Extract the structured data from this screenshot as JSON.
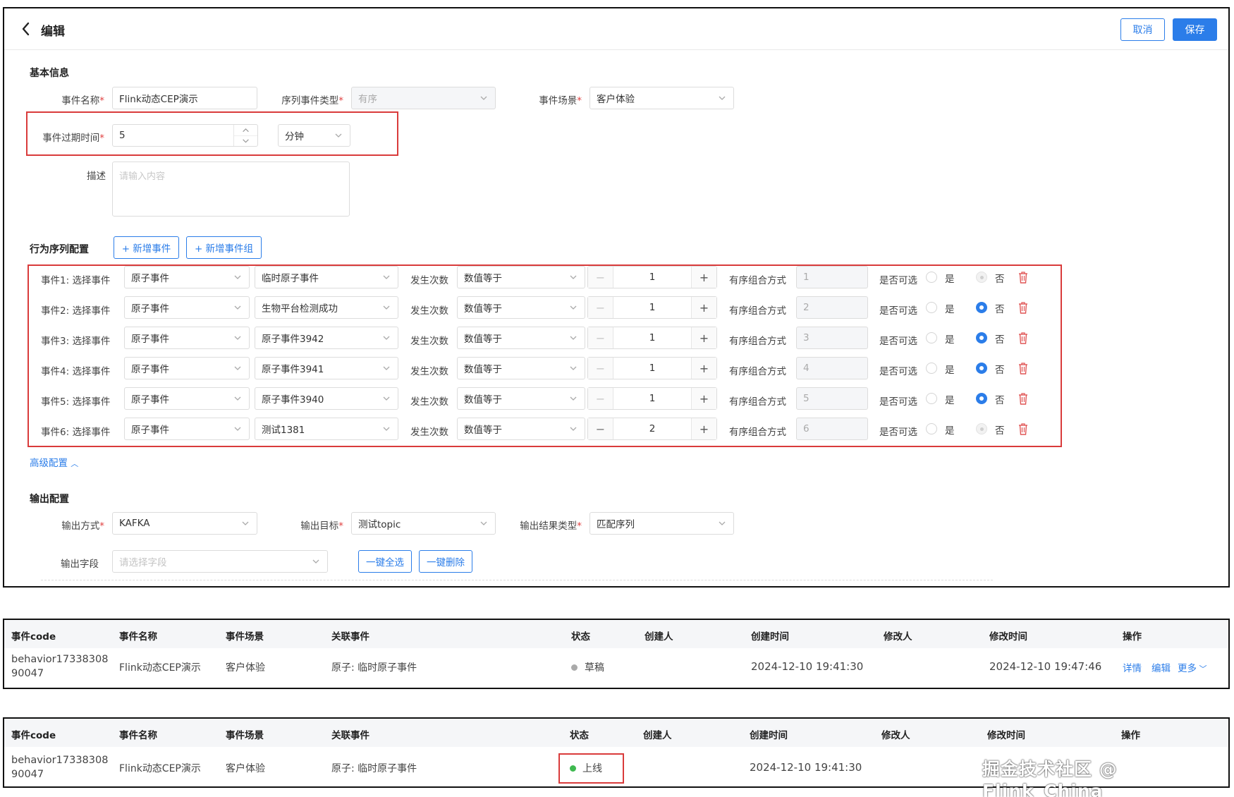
{
  "header": {
    "title": "编辑",
    "cancel": "取消",
    "save": "保存"
  },
  "basic": {
    "section": "基本信息",
    "event_name_label": "事件名称",
    "event_name_value": "Flink动态CEP演示",
    "seq_type_label": "序列事件类型",
    "seq_type_value": "有序",
    "scene_label": "事件场景",
    "scene_value": "客户体验",
    "expire_label": "事件过期时间",
    "expire_value": "5",
    "expire_unit": "分钟",
    "desc_label": "描述",
    "desc_placeholder": "请输入内容",
    "req": "*"
  },
  "behavior": {
    "section": "行为序列配置",
    "add_event": "+ 新增事件",
    "add_group": "+ 新增事件组",
    "select_label": "选择事件",
    "count_label": "发生次数",
    "order_label": "有序组合方式",
    "optional_label": "是否可选",
    "yes": "是",
    "no": "否",
    "minus": "−",
    "plus": "+",
    "rows": [
      {
        "label": "事件1:",
        "type": "原子事件",
        "event": "临时原子事件",
        "cond": "数值等于",
        "count": "1",
        "order": "1",
        "no_state": "disabled"
      },
      {
        "label": "事件2:",
        "type": "原子事件",
        "event": "生物平台检测成功",
        "cond": "数值等于",
        "count": "1",
        "order": "2",
        "no_state": "on"
      },
      {
        "label": "事件3:",
        "type": "原子事件",
        "event": "原子事件3942",
        "cond": "数值等于",
        "count": "1",
        "order": "3",
        "no_state": "on"
      },
      {
        "label": "事件4:",
        "type": "原子事件",
        "event": "原子事件3941",
        "cond": "数值等于",
        "count": "1",
        "order": "4",
        "no_state": "on"
      },
      {
        "label": "事件5:",
        "type": "原子事件",
        "event": "原子事件3940",
        "cond": "数值等于",
        "count": "1",
        "order": "5",
        "no_state": "on"
      },
      {
        "label": "事件6:",
        "type": "原子事件",
        "event": "测试1381",
        "cond": "数值等于",
        "count": "2",
        "order": "6",
        "no_state": "disabled"
      }
    ],
    "advanced": "高级配置"
  },
  "output": {
    "section": "输出配置",
    "mode_label": "输出方式",
    "mode_value": "KAFKA",
    "target_label": "输出目标",
    "target_value": "测试topic",
    "result_label": "输出结果类型",
    "result_value": "匹配序列",
    "fields_label": "输出字段",
    "fields_placeholder": "请选择字段",
    "select_all": "一键全选",
    "delete_all": "一键删除"
  },
  "table": {
    "headers": [
      "事件code",
      "事件名称",
      "事件场景",
      "关联事件",
      "状态",
      "创建人",
      "创建时间",
      "修改人",
      "修改时间",
      "操作"
    ],
    "row1": {
      "code_line1": "behavior17338308",
      "code_line2": "90047",
      "name": "Flink动态CEP演示",
      "scene": "客户体验",
      "related": "原子: 临时原子事件",
      "status": "草稿",
      "created": "2024-12-10 19:41:30",
      "modified": "2024-12-10 19:47:46",
      "action_detail": "详情",
      "action_edit": "编辑",
      "action_more": "更多"
    },
    "row2": {
      "code_line1": "behavior17338308",
      "code_line2": "90047",
      "name": "Flink动态CEP演示",
      "scene": "客户体验",
      "related": "原子: 临时原子事件",
      "status": "上线",
      "created": "2024-12-10 19:41:30"
    }
  },
  "watermark": "掘金技术社区 @ Flink_China",
  "colors": {
    "accent": "#2b7de9",
    "highlight": "#d93b3b",
    "draft": "#aaaaaa",
    "online": "#3fb950"
  }
}
